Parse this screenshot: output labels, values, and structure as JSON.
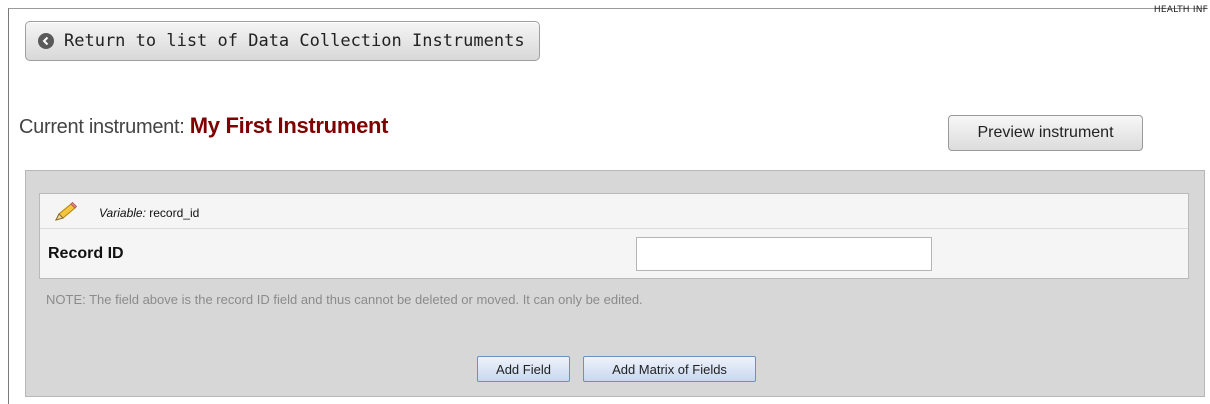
{
  "header": {
    "corner_text": "HEALTH INF"
  },
  "nav": {
    "return_label": "Return to list of Data Collection Instruments"
  },
  "instrument": {
    "label": "Current instrument:",
    "name": "My First Instrument",
    "preview_label": "Preview instrument"
  },
  "field": {
    "variable_label": "Variable:",
    "variable_name": "record_id",
    "label": "Record ID",
    "value": ""
  },
  "note": "NOTE: The field above is the record ID field and thus cannot be deleted or moved. It can only be edited.",
  "actions": {
    "add_field": "Add Field",
    "add_matrix": "Add Matrix of Fields"
  },
  "colors": {
    "instrument_name": "#800000",
    "panel_bg": "#d7d7d7",
    "button_blue_border": "#6d8fc7"
  }
}
